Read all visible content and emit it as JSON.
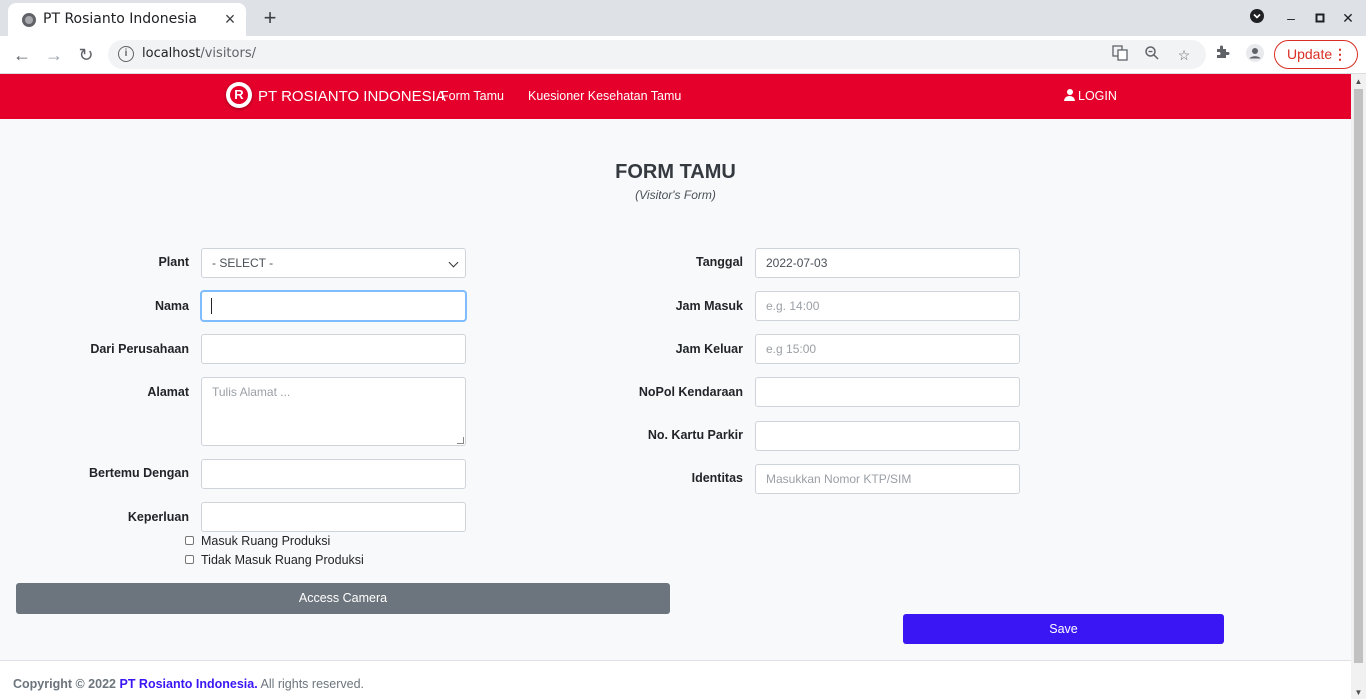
{
  "browser": {
    "tab_title": "PT Rosianto Indonesia",
    "url_host": "localhost",
    "url_path": "/visitors/",
    "update_label": "Update"
  },
  "navbar": {
    "brand": "PT ROSIANTO INDONESIA",
    "logo_letter": "R",
    "links": [
      "Form Tamu",
      "Kuesioner Kesehatan Tamu"
    ],
    "login": "LOGIN",
    "color": "#e4002b"
  },
  "form": {
    "title": "FORM TAMU",
    "subtitle": "(Visitor's Form)",
    "left": {
      "plant_label": "Plant",
      "plant_value": "- SELECT -",
      "nama_label": "Nama",
      "nama_value": "",
      "perusahaan_label": "Dari Perusahaan",
      "perusahaan_value": "",
      "alamat_label": "Alamat",
      "alamat_placeholder": "Tulis Alamat ...",
      "bertemu_label": "Bertemu Dengan",
      "bertemu_value": "",
      "keperluan_label": "Keperluan",
      "keperluan_value": "",
      "check1": "Masuk Ruang Produksi",
      "check2": "Tidak Masuk Ruang Produksi"
    },
    "right": {
      "tanggal_label": "Tanggal",
      "tanggal_value": "2022-07-03",
      "jam_masuk_label": "Jam Masuk",
      "jam_masuk_placeholder": "e.g. 14:00",
      "jam_keluar_label": "Jam Keluar",
      "jam_keluar_placeholder": "e.g 15:00",
      "nopol_label": "NoPol Kendaraan",
      "nopol_value": "",
      "kartu_label": "No. Kartu Parkir",
      "kartu_value": "",
      "identitas_label": "Identitas",
      "identitas_placeholder": "Masukkan Nomor KTP/SIM"
    },
    "camera_button": "Access Camera",
    "save_button": "Save"
  },
  "footer": {
    "copyright": "Copyright © 2022",
    "company": "PT Rosianto Indonesia.",
    "rights": "All rights reserved."
  }
}
